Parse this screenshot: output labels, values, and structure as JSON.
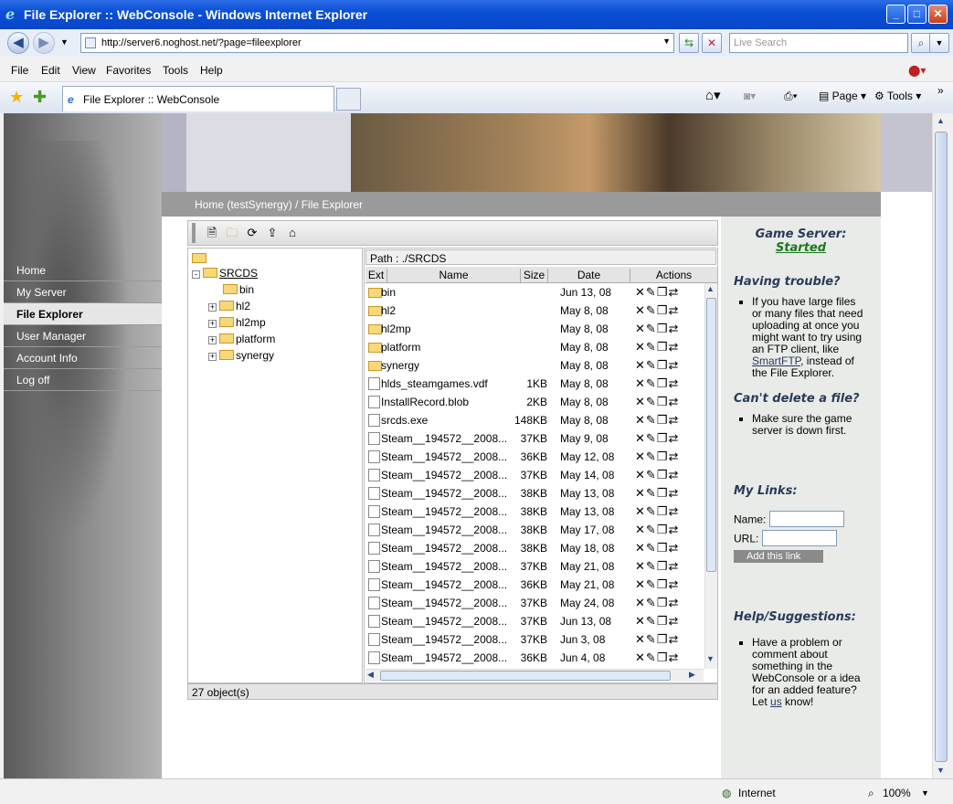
{
  "window": {
    "title": "File Explorer :: WebConsole - Windows Internet Explorer"
  },
  "address": {
    "url": "http://server6.noghost.net/?page=fileexplorer",
    "search_placeholder": "Live Search"
  },
  "menu": [
    "File",
    "Edit",
    "View",
    "Favorites",
    "Tools",
    "Help"
  ],
  "tab": {
    "label": "File Explorer :: WebConsole"
  },
  "commands": {
    "page": "Page",
    "tools": "Tools"
  },
  "nav": [
    "Home",
    "My Server",
    "File Explorer",
    "User Manager",
    "Account Info",
    "Log off"
  ],
  "breadcrumb": "Home (testSynergy) / File Explorer",
  "tree": {
    "root": "SRCDS",
    "children": [
      "bin",
      "hl2",
      "hl2mp",
      "platform",
      "synergy"
    ]
  },
  "files": {
    "path": "Path : ./SRCDS",
    "columns": [
      "Ext",
      "Name",
      "Size",
      "Date",
      "Actions"
    ],
    "rows": [
      {
        "name": "bin",
        "size": "",
        "date": "Jun 13, 08",
        "folder": true
      },
      {
        "name": "hl2",
        "size": "",
        "date": "May 8, 08",
        "folder": true
      },
      {
        "name": "hl2mp",
        "size": "",
        "date": "May 8, 08",
        "folder": true
      },
      {
        "name": "platform",
        "size": "",
        "date": "May 8, 08",
        "folder": true
      },
      {
        "name": "synergy",
        "size": "",
        "date": "May 8, 08",
        "folder": true
      },
      {
        "name": "hlds_steamgames.vdf",
        "size": "1KB",
        "date": "May 8, 08",
        "folder": false
      },
      {
        "name": "InstallRecord.blob",
        "size": "2KB",
        "date": "May 8, 08",
        "folder": false
      },
      {
        "name": "srcds.exe",
        "size": "148KB",
        "date": "May 8, 08",
        "folder": false
      },
      {
        "name": "Steam__194572__2008...",
        "size": "37KB",
        "date": "May 9, 08",
        "folder": false
      },
      {
        "name": "Steam__194572__2008...",
        "size": "36KB",
        "date": "May 12, 08",
        "folder": false
      },
      {
        "name": "Steam__194572__2008...",
        "size": "37KB",
        "date": "May 14, 08",
        "folder": false
      },
      {
        "name": "Steam__194572__2008...",
        "size": "38KB",
        "date": "May 13, 08",
        "folder": false
      },
      {
        "name": "Steam__194572__2008...",
        "size": "38KB",
        "date": "May 13, 08",
        "folder": false
      },
      {
        "name": "Steam__194572__2008...",
        "size": "38KB",
        "date": "May 17, 08",
        "folder": false
      },
      {
        "name": "Steam__194572__2008...",
        "size": "38KB",
        "date": "May 18, 08",
        "folder": false
      },
      {
        "name": "Steam__194572__2008...",
        "size": "37KB",
        "date": "May 21, 08",
        "folder": false
      },
      {
        "name": "Steam__194572__2008...",
        "size": "36KB",
        "date": "May 21, 08",
        "folder": false
      },
      {
        "name": "Steam__194572__2008...",
        "size": "37KB",
        "date": "May 24, 08",
        "folder": false
      },
      {
        "name": "Steam__194572__2008...",
        "size": "37KB",
        "date": "Jun 13, 08",
        "folder": false
      },
      {
        "name": "Steam__194572__2008...",
        "size": "37KB",
        "date": "Jun 3, 08",
        "folder": false
      },
      {
        "name": "Steam__194572__2008...",
        "size": "36KB",
        "date": "Jun 4, 08",
        "folder": false
      }
    ],
    "status": "27 object(s)"
  },
  "side": {
    "game_server_label": "Game Server:",
    "game_server_status": "Started",
    "trouble_title": "Having trouble?",
    "trouble_text_1": "If you have large files or many files that need uploading at once you might want to try using an FTP client, like ",
    "trouble_link": "SmartFTP",
    "trouble_text_2": ", instead of the File Explorer.",
    "delete_title": "Can't delete a file?",
    "delete_text": "Make sure the game server is down first.",
    "links_title": "My Links:",
    "name_label": "Name:",
    "url_label": "URL:",
    "add_link": "Add this link",
    "help_title": "Help/Suggestions:",
    "help_text_1": "Have a problem or comment about something in the WebConsole or a idea for an added feature? Let ",
    "help_link": "us",
    "help_text_2": " know!"
  },
  "statusbar": {
    "zone": "Internet",
    "zoom": "100%"
  },
  "colors": {
    "status_green": "#1a7a1a"
  }
}
